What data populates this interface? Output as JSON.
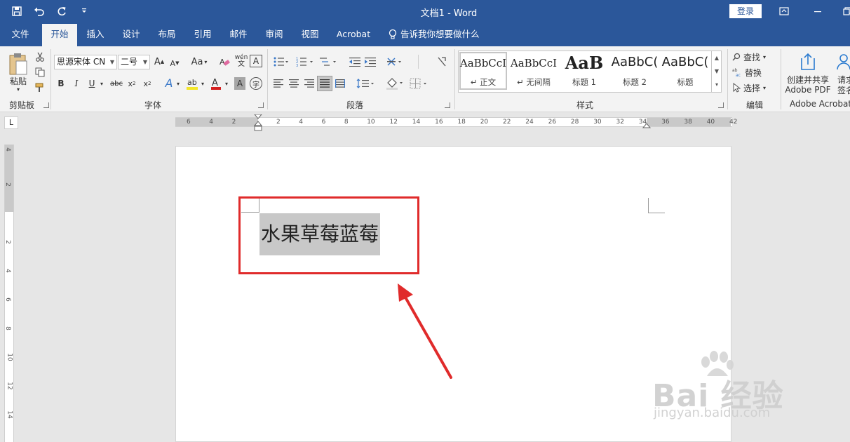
{
  "titlebar": {
    "doc_title": "文档1 - Word",
    "login_label": "登录",
    "bg_color": "#2b579a"
  },
  "tabs": [
    {
      "label": "文件"
    },
    {
      "label": "开始",
      "active": true
    },
    {
      "label": "插入"
    },
    {
      "label": "设计"
    },
    {
      "label": "布局"
    },
    {
      "label": "引用"
    },
    {
      "label": "邮件"
    },
    {
      "label": "审阅"
    },
    {
      "label": "视图"
    },
    {
      "label": "Acrobat"
    }
  ],
  "tell_me": "告诉我你想要做什么",
  "ribbon": {
    "clipboard": {
      "paste_label": "粘贴",
      "group_label": "剪贴板"
    },
    "font": {
      "font_name": "思源宋体 CN",
      "font_size": "二号",
      "case_label": "Aa",
      "phonetic_label": "wén",
      "group_label": "字体"
    },
    "paragraph": {
      "group_label": "段落"
    },
    "styles": {
      "group_label": "样式",
      "items": [
        {
          "sample": "AaBbCcI",
          "name": "↵ 正文"
        },
        {
          "sample": "AaBbCcI",
          "name": "↵ 无间隔"
        },
        {
          "sample": "AaB",
          "name": "标题 1"
        },
        {
          "sample": "AaBbC(",
          "name": "标题 2"
        },
        {
          "sample": "AaBbC(",
          "name": "标题"
        }
      ]
    },
    "editing": {
      "find_label": "查找",
      "replace_label": "替换",
      "select_label": "选择",
      "group_label": "编辑"
    },
    "acrobat": {
      "create_label_1": "创建并共享",
      "create_label_2": "Adobe PDF",
      "request_label_1": "请求",
      "request_label_2": "签名",
      "group_label": "Adobe Acrobat"
    }
  },
  "ruler": {
    "h_numbers": [
      "6",
      "4",
      "2",
      "2",
      "4",
      "6",
      "8",
      "10",
      "12",
      "14",
      "16",
      "18",
      "20",
      "22",
      "24",
      "26",
      "28",
      "30",
      "32",
      "34",
      "36",
      "38",
      "40",
      "42"
    ],
    "v_numbers": [
      "4",
      "2",
      "2",
      "4",
      "6",
      "8",
      "10",
      "12",
      "14"
    ],
    "tab_selector": "L"
  },
  "document": {
    "selected_text": "水果草莓蓝莓"
  },
  "annotation": {
    "box_color": "#e02b2b"
  },
  "watermark": {
    "brand": "Bai  经验",
    "url": "jingyan.baidu.com"
  }
}
